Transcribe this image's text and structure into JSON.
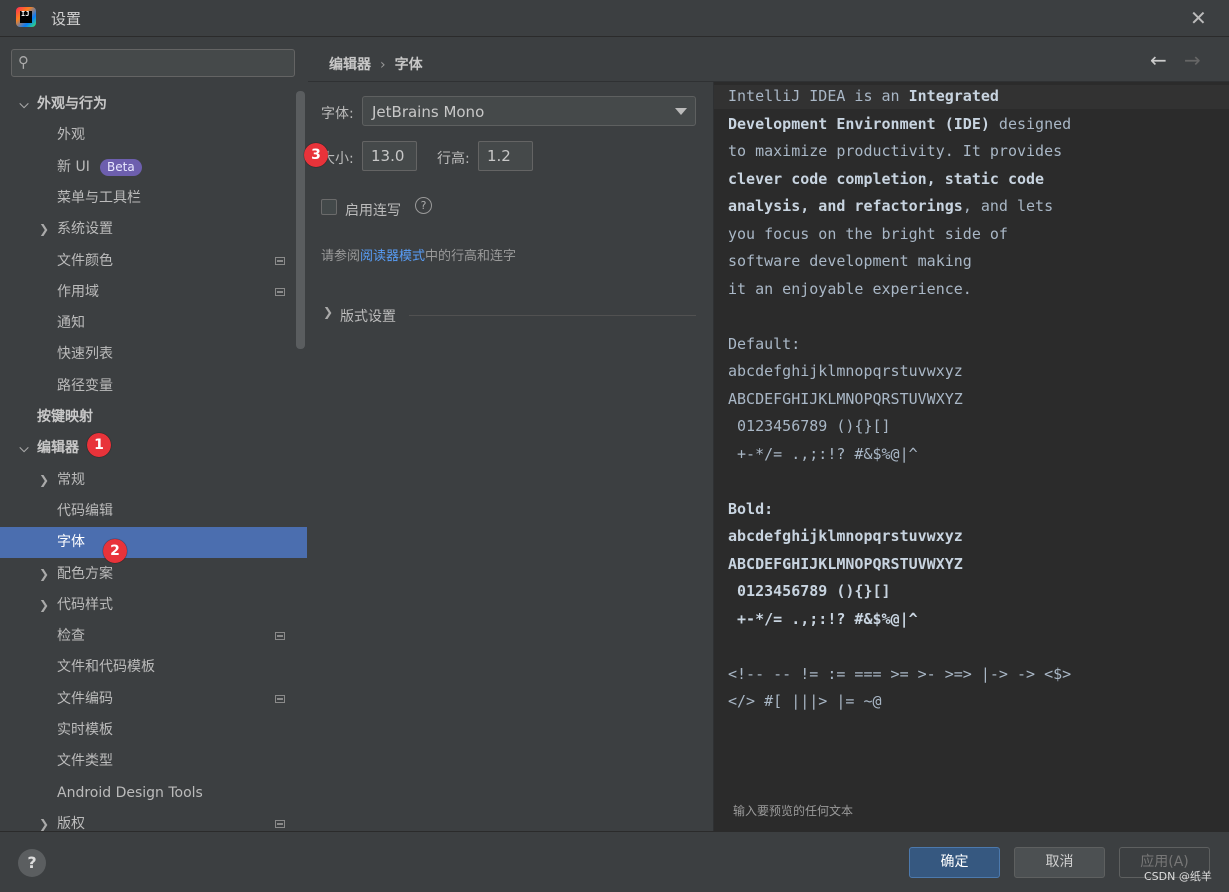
{
  "window": {
    "title": "设置"
  },
  "search": {
    "placeholder": ""
  },
  "sidebar": {
    "items": [
      {
        "label": "外观与行为",
        "indent": 0,
        "chevron": "expanded",
        "bold": true
      },
      {
        "label": "外观",
        "indent": 1
      },
      {
        "label": "新 UI",
        "indent": 1,
        "badge": "Beta"
      },
      {
        "label": "菜单与工具栏",
        "indent": 1
      },
      {
        "label": "系统设置",
        "indent": 1,
        "chevron": "collapsed"
      },
      {
        "label": "文件颜色",
        "indent": 1,
        "icon": "page-icon"
      },
      {
        "label": "作用域",
        "indent": 1,
        "icon": "page-icon"
      },
      {
        "label": "通知",
        "indent": 1
      },
      {
        "label": "快速列表",
        "indent": 1
      },
      {
        "label": "路径变量",
        "indent": 1
      },
      {
        "label": "按键映射",
        "indent": 0,
        "bold": true
      },
      {
        "label": "编辑器",
        "indent": 0,
        "chevron": "expanded",
        "bold": true
      },
      {
        "label": "常规",
        "indent": 1,
        "chevron": "collapsed"
      },
      {
        "label": "代码编辑",
        "indent": 1
      },
      {
        "label": "字体",
        "indent": 1,
        "selected": true
      },
      {
        "label": "配色方案",
        "indent": 1,
        "chevron": "collapsed"
      },
      {
        "label": "代码样式",
        "indent": 1,
        "chevron": "collapsed"
      },
      {
        "label": "检查",
        "indent": 1,
        "icon": "page-icon"
      },
      {
        "label": "文件和代码模板",
        "indent": 1
      },
      {
        "label": "文件编码",
        "indent": 1,
        "icon": "page-icon"
      },
      {
        "label": "实时模板",
        "indent": 1
      },
      {
        "label": "文件类型",
        "indent": 1
      },
      {
        "label": "Android Design Tools",
        "indent": 1
      },
      {
        "label": "版权",
        "indent": 1,
        "chevron": "collapsed",
        "icon": "page-icon"
      }
    ]
  },
  "annotations": [
    "1",
    "2",
    "3"
  ],
  "breadcrumb": {
    "parent": "编辑器",
    "sep": "›",
    "current": "字体"
  },
  "nav": {
    "back": "←",
    "forward": "→"
  },
  "font_settings": {
    "font_label": "字体:",
    "font_value": "JetBrains Mono",
    "size_label": "大小:",
    "size_value": "13.0",
    "line_height_label": "行高:",
    "line_height_value": "1.2",
    "ligatures_label": "启用连写",
    "ligatures_checked": false,
    "help_glyph": "?",
    "reader_prefix": "请参阅",
    "reader_link": "阅读器模式",
    "reader_suffix": "中的行高和连字",
    "layout_section": "版式设置"
  },
  "preview": {
    "text": "IntelliJ IDEA is an Integrated\nDevelopment Environment (IDE) designed\nto maximize productivity. It provides\nclever code completion, static code\nanalysis, and refactorings, and lets\nyou focus on the bright side of\nsoftware development making\nit an enjoyable experience.\n\nDefault:\nabcdefghijklmnopqrstuvwxyz\nABCDEFGHIJKLMNOPQRSTUVWXYZ\n 0123456789 (){}[]\n +-*/= .,;:!? #&$%@|^\n\nBold:\nabcdefghijklmnopqrstuvwxyz\nABCDEFGHIJKLMNOPQRSTUVWXYZ\n 0123456789 (){}[]\n +-*/= .,;:!? #&$%@|^\n\n<!-- -- != := === >= >- >=> |-> -> <$>\n</> #[ |||> |= ~@",
    "hint": "输入要预览的任何文本"
  },
  "footer": {
    "help": "?",
    "ok": "确定",
    "cancel": "取消",
    "apply": "应用(A)",
    "watermark": "CSDN @纸羊"
  },
  "colors": {
    "selected": "#4b6eaf",
    "link": "#589df6",
    "badge": "#e8333a",
    "primary_button": "#365880"
  }
}
